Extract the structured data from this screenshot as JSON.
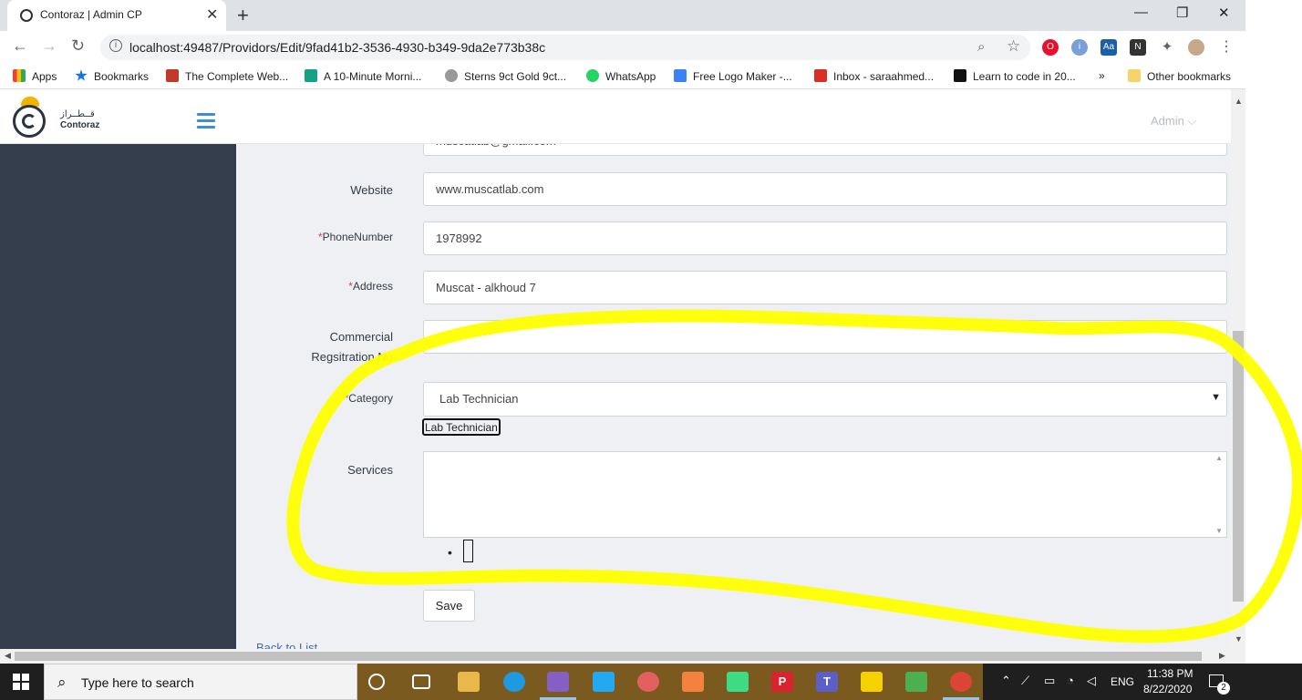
{
  "browser": {
    "tab_title": "Contoraz | Admin CP",
    "url": "localhost:49487/Providors/Edit/9fad41b2-3536-4930-b349-9da2e773b38c",
    "win_min": "—",
    "win_max": "❐",
    "win_close": "✕",
    "new_tab": "+",
    "tab_close": "✕"
  },
  "bookmarks": {
    "items": [
      {
        "label": "Apps",
        "color": "#e84335"
      },
      {
        "label": "Bookmarks",
        "color": "#1a73e8"
      },
      {
        "label": "The Complete Web...",
        "color": "#c0392b"
      },
      {
        "label": "A 10-Minute Morni...",
        "color": "#16a085"
      },
      {
        "label": "Sterns 9ct Gold 9ct...",
        "color": "#777777"
      },
      {
        "label": "WhatsApp",
        "color": "#25d366"
      },
      {
        "label": "Free Logo Maker -...",
        "color": "#3b82f6"
      },
      {
        "label": "Inbox - saraahmed...",
        "color": "#d93025"
      },
      {
        "label": "Learn to code in 20...",
        "color": "#111111"
      }
    ],
    "overflow": "»",
    "other": "Other bookmarks"
  },
  "app": {
    "brand_ar": "قــطــراز",
    "brand_en": "Contoraz",
    "admin_label": "Admin ⌵"
  },
  "form": {
    "email_partial": "muscatlab@gmail.com",
    "website_label": "Website",
    "website_value": "www.muscatlab.com",
    "required_mark": "*",
    "phone_label": "PhoneNumber",
    "phone_value": "1978992",
    "address_label": "Address",
    "address_value": "Muscat - alkhoud 7",
    "commercial_label_1": "Commercial",
    "commercial_label_2": "Regsitration No",
    "commercial_value": "",
    "category_label": "Category",
    "category_value": "Lab Technician",
    "category_chip": "Lab Technician",
    "services_label": "Services",
    "save_label": "Save",
    "back_label": "Back to List"
  },
  "taskbar": {
    "search_placeholder": "Type here to search",
    "lang": "ENG",
    "time": "11:38 PM",
    "date": "8/22/2020",
    "notif_count": "2"
  },
  "colors": {
    "sidebar": "#343d4b",
    "annotation": "#ffff00",
    "accent": "#3d8fd1"
  }
}
